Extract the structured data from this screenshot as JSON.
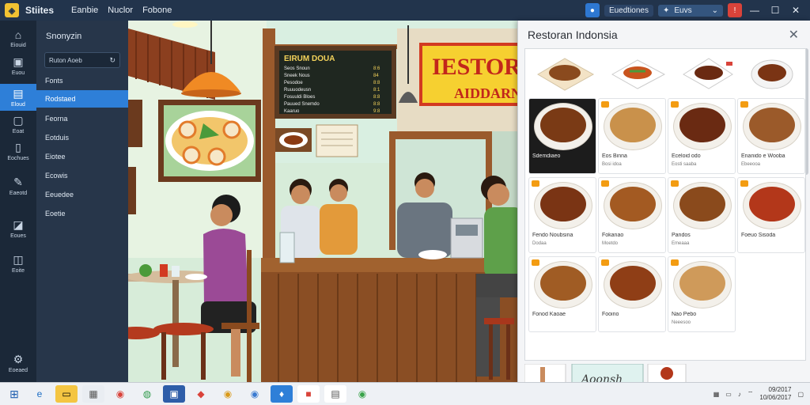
{
  "topbar": {
    "app_title": "Stiites",
    "menu": [
      "Eanbie",
      "Nuclor",
      "Fobone"
    ],
    "btn1_label": "Euedtiones",
    "dropdown_label": "Euvs",
    "win_min": "—",
    "win_max": "☐",
    "win_close": "✕"
  },
  "rail": {
    "items": [
      {
        "label": "Eiouid",
        "icon": "home-icon"
      },
      {
        "label": "Euou",
        "icon": "image-icon"
      },
      {
        "label": "Eloud",
        "icon": "gallery-icon"
      },
      {
        "label": "Eoat",
        "icon": "layers-icon"
      },
      {
        "label": "Eochues",
        "icon": "document-icon"
      },
      {
        "label": "Eaeotd",
        "icon": "pen-icon"
      },
      {
        "label": "Eoues",
        "icon": "tag-icon"
      },
      {
        "label": "Eoite",
        "icon": "crop-icon"
      },
      {
        "label": "Eoeaed",
        "icon": "settings-icon"
      }
    ]
  },
  "side": {
    "heading": "Snonyzin",
    "search_value": "Ruton Aoeb",
    "items": [
      "Fonts",
      "Rodstaed",
      "Feorna",
      "Eotduis",
      "Eiotee",
      "Ecowis",
      "Eeuedee",
      "Eoetie"
    ],
    "active_index": 1
  },
  "scene": {
    "menu_board_title": "EIRUM DOUA",
    "menu_board_lines": [
      [
        "Seos Snoun",
        "8:6"
      ],
      [
        "Sneek Nous",
        "84"
      ],
      [
        "Pesodoe",
        "8:8"
      ],
      [
        "Ruuuodeusn",
        "8:1"
      ],
      [
        "Fosuuldi Bloes",
        "8:8"
      ],
      [
        "Pauued Snemdo",
        "8:8"
      ],
      [
        "Kaaruo",
        "9:8"
      ]
    ],
    "banner_line1": "IESTORAI",
    "banner_line2": "AIDDARNLS"
  },
  "dialog": {
    "title": "Restoran Indonsia",
    "close": "✕",
    "cards": [
      {
        "name": "Sdemdiaeo",
        "desc": "",
        "color": "#7a3a15",
        "dark": true
      },
      {
        "name": "Eos Binna",
        "desc": "Bosi idoa",
        "color": "#c9914b",
        "dark": false
      },
      {
        "name": "Eceloid odo",
        "desc": "Eosti saaba",
        "color": "#6a2a12",
        "dark": false
      },
      {
        "name": "Enanido e Wooba",
        "desc": "Ebeeooa",
        "color": "#9b5a2a",
        "dark": false
      },
      {
        "name": "Fendo Noubsina",
        "desc": "Dodaa",
        "color": "#7a3414",
        "dark": false
      },
      {
        "name": "Fokanao",
        "desc": "Moetdo",
        "color": "#a35a22",
        "dark": false
      },
      {
        "name": "Pandos",
        "desc": "Emeaaa",
        "color": "#8a4a1c",
        "dark": false
      },
      {
        "name": "Foeuo Sisoda",
        "desc": "",
        "color": "#b3371a",
        "dark": false
      },
      {
        "name": "Fonod Kaoae",
        "desc": "",
        "color": "#a05c24",
        "dark": false
      },
      {
        "name": "Fooino",
        "desc": "",
        "color": "#8f3e16",
        "dark": false
      },
      {
        "name": "Nao Pebo",
        "desc": "Neeesoo",
        "color": "#cf9a5a",
        "dark": false
      }
    ],
    "sticker_text": "Aoonsh"
  },
  "taskbar": {
    "clock_time": "09/2017",
    "clock_date": "10/06/2017"
  }
}
